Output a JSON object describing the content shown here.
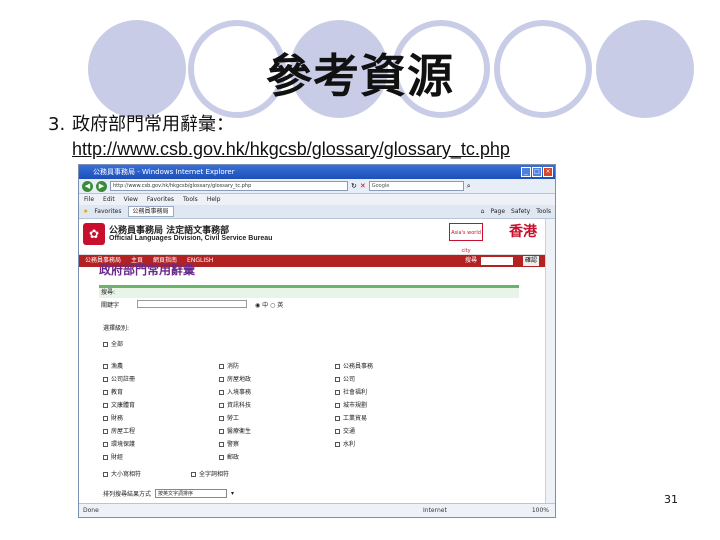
{
  "slide": {
    "title": "參考資源",
    "point_number": "3.",
    "point_text": "政府部門常用辭彙：",
    "url": "http://www.csb.gov.hk/hkgcsb/glossary/glossary_tc.php",
    "page_number": "31"
  },
  "browser": {
    "window_title": "公務員事務局 - Windows Internet Explorer",
    "address": "http://www.csb.gov.hk/hkgcsb/glossary/glossary_tc.php",
    "search_engine": "Google",
    "menu": [
      "File",
      "Edit",
      "View",
      "Favorites",
      "Tools",
      "Help"
    ],
    "favorites_label": "Favorites",
    "tab_label": "公務員事務局",
    "commands": [
      "Page",
      "Safety",
      "Tools"
    ],
    "status_left": "Done",
    "status_zone": "Internet",
    "status_zoom": "100%"
  },
  "site": {
    "name_zh": "公務員事務局 法定語文事務部",
    "name_en": "Official Languages Division, Civil Service Bureau",
    "asia_badge": "Asia's world city",
    "hk_badge": "香港",
    "nav": [
      "公務員事務局",
      "主頁",
      "網頁指南",
      "ENGLISH"
    ],
    "search_label": "搜尋",
    "ok_label": "確認",
    "page_heading": "政府部門常用辭彙",
    "panel_head": "搜尋:",
    "term_label": "關鍵字",
    "radio_options": "◉ 中  ○ 英",
    "filter_label": "選擇級別:",
    "all_label": "全部",
    "categories": [
      "漁農",
      "消防",
      "公務員事務",
      "公司註冊",
      "房屋地政",
      "公司",
      "教育",
      "入境事務",
      "社會福利",
      "文康體育",
      "資訊科技",
      "城市規劃",
      "財務",
      "勞工",
      "工業貿易",
      "房屋工程",
      "醫療衞生",
      "交通",
      "環境保護",
      "警察",
      "水利",
      "財經",
      "郵政"
    ],
    "opt_case": "大小寫相符",
    "opt_whole": "全字詞相符",
    "sort_label": "排列搜尋結果方式",
    "sort_value": "按英文字詞排序"
  }
}
